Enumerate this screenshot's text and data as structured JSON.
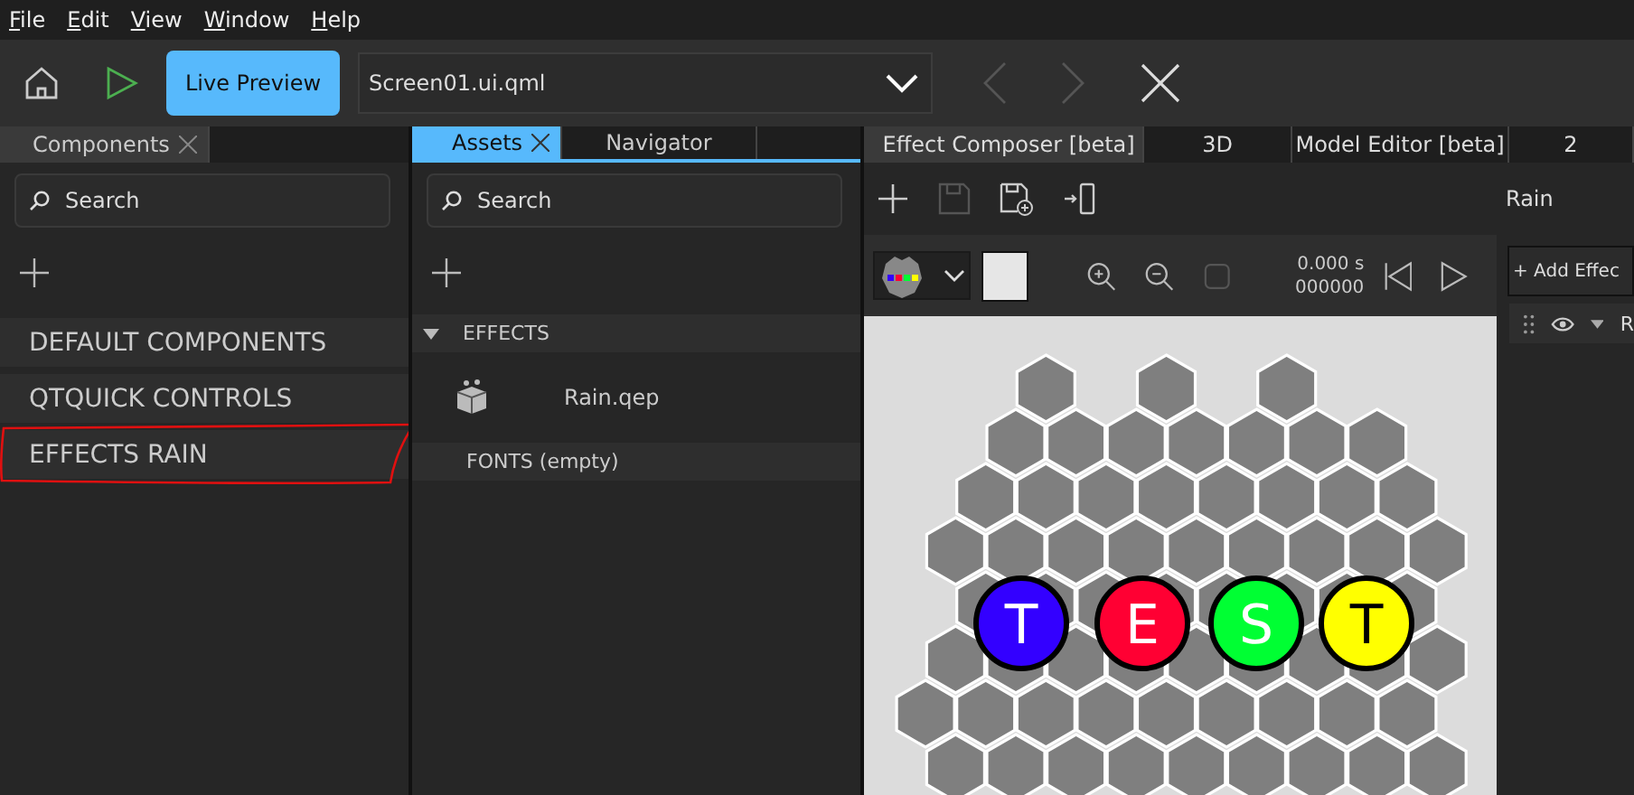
{
  "menu": [
    "File",
    "Edit",
    "View",
    "Window",
    "Help"
  ],
  "toolbar": {
    "live_preview": "Live Preview",
    "file": "Screen01.ui.qml",
    "nav": [
      {
        "kind": "back",
        "disabled": true
      },
      {
        "kind": "forward",
        "disabled": true
      }
    ]
  },
  "components_panel": {
    "tabs": [
      {
        "label": "Components",
        "selected": true
      }
    ],
    "search": {
      "placeholder": "Search"
    },
    "items": [
      {
        "label": "DEFAULT COMPONENTS",
        "annotated": false
      },
      {
        "label": "QTQUICK CONTROLS",
        "annotated": false
      },
      {
        "label": "EFFECTS RAIN",
        "annotated": true
      }
    ]
  },
  "assets_panel": {
    "tabs": [
      {
        "label": "Assets",
        "selected": true
      },
      {
        "label": "Navigator",
        "selected": false
      }
    ],
    "search": {
      "placeholder": "Search"
    },
    "sections": [
      {
        "label": "EFFECTS",
        "expanded": true,
        "children": [
          {
            "label": "Rain.qep"
          }
        ]
      },
      {
        "label": "FONTS (empty)"
      }
    ]
  },
  "effect_panel": {
    "tabs": [
      {
        "label": "Effect Composer [beta]",
        "selected": true
      },
      {
        "label": "3D",
        "selected": false
      },
      {
        "label": "Model Editor [beta]",
        "selected": false
      },
      {
        "label": "2",
        "selected": false
      }
    ],
    "tools": [
      {
        "kind": "add",
        "disabled": false
      },
      {
        "kind": "save",
        "disabled": true
      },
      {
        "kind": "save-as",
        "disabled": false
      },
      {
        "kind": "assign",
        "disabled": false
      }
    ],
    "title": "Rain",
    "time": "0.000 s",
    "frame": "000000",
    "fit_disabled": true,
    "add_effect": "+ Add Effec",
    "node_label": "R",
    "preview_letters": [
      {
        "text": "T",
        "color": "#3300ff"
      },
      {
        "text": "E",
        "color": "#ff0033"
      },
      {
        "text": "S",
        "color": "#00ff33"
      },
      {
        "text": "T",
        "color": "#ffff00"
      }
    ]
  }
}
